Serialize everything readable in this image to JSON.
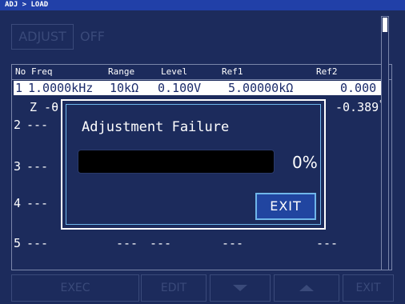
{
  "breadcrumb": "ADJ > LOAD",
  "mode": {
    "label": "ADJUST",
    "state": "OFF"
  },
  "table": {
    "headers": [
      "No",
      "Freq",
      "Range",
      "Level",
      "Ref1",
      "Ref2"
    ],
    "row1": {
      "no": "1",
      "freq": "1.0000kHz",
      "range": "10kΩ",
      "level": "0.100V",
      "ref1": "5.00000kΩ",
      "ref2": "0.000",
      "deg": "°"
    },
    "row1b": {
      "param": "Z -θ",
      "ref2": "-0.389",
      "deg": "°"
    },
    "rows": [
      {
        "no": "2",
        "freq": "---"
      },
      {
        "no": "3",
        "freq": "---"
      },
      {
        "no": "4",
        "freq": "---"
      },
      {
        "no": "5",
        "freq": "---",
        "range": "---",
        "level": "---",
        "ref1": "---",
        "ref2": "---"
      }
    ]
  },
  "dialog": {
    "title": "Adjustment Failure",
    "progress_percent": 0,
    "progress_label": "0%",
    "exit_label": "EXIT"
  },
  "footer": {
    "exec": "EXEC",
    "edit": "EDIT",
    "exit": "EXIT",
    "down_icon": "triangle-down-icon",
    "up_icon": "triangle-up-icon"
  }
}
